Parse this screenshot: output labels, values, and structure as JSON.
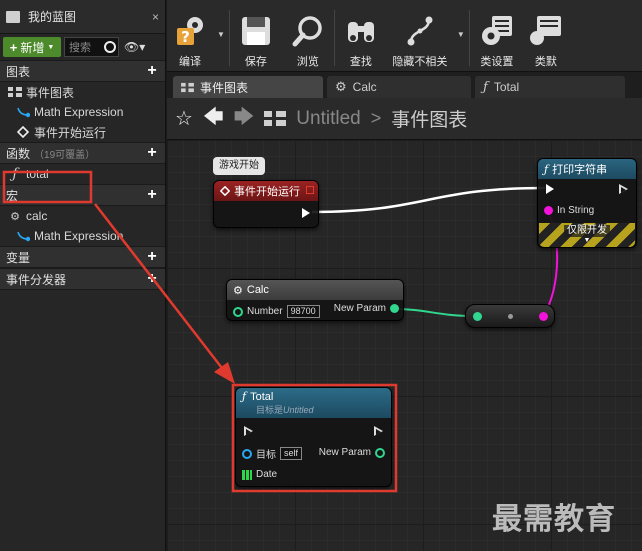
{
  "left_panel": {
    "title": "我的蓝图",
    "close": "×",
    "add_button": "新增",
    "search_placeholder": "搜索",
    "sections": {
      "graphs": "图表",
      "functions": "函数",
      "functions_hint": "（19可覆盖）",
      "macros": "宏",
      "variables": "变量",
      "dispatchers": "事件分发器"
    },
    "graph_items": [
      "事件图表",
      "Math Expression",
      "事件开始运行"
    ],
    "function_items": [
      "total"
    ],
    "macro_items": [
      "calc",
      "Math Expression"
    ]
  },
  "toolbar": {
    "compile": "编译",
    "save": "保存",
    "browse": "浏览",
    "find": "查找",
    "hide_unrelated": "隐藏不相关",
    "class_settings": "类设置",
    "class_defaults": "类默"
  },
  "tabs": [
    {
      "label": "事件图表",
      "icon": "event-graph-icon"
    },
    {
      "label": "Calc",
      "icon": "gear-icon"
    },
    {
      "label": "Total",
      "icon": "function-icon"
    }
  ],
  "breadcrumb": {
    "blueprint": "Untitled",
    "separator": ">",
    "graph": "事件图表"
  },
  "graph": {
    "comment_bubble": "游戏开始",
    "event_node": {
      "title": "事件开始运行"
    },
    "print_node": {
      "title": "打印字符串",
      "in_string": "In String",
      "dev_only": "仅限开发"
    },
    "calc_node": {
      "title": "Calc",
      "number_label": "Number",
      "number_value": "98700",
      "out_label": "New Param"
    },
    "total_node": {
      "title": "Total",
      "subtitle_prefix": "目标是",
      "subtitle_target": "Untitled",
      "target_label": "目标",
      "target_value": "self",
      "out_label": "New Param",
      "date_label": "Date"
    }
  },
  "watermark": "最需教育",
  "colors": {
    "accent_red": "#e03a2f",
    "event_header": "#8b1c1c",
    "function_header": "#1f4d66",
    "string_pin": "#f212d9",
    "float_pin": "#31d68f",
    "object_pin": "#2aa7f2",
    "struct_pin": "#2bd649"
  }
}
